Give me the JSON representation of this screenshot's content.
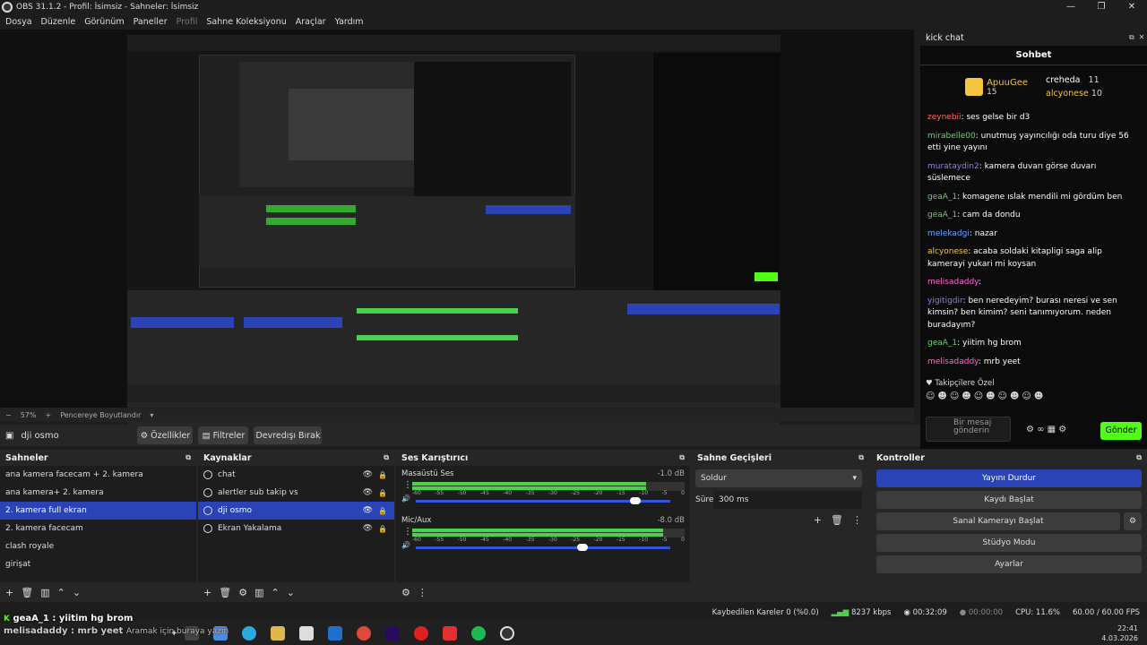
{
  "window": {
    "title": "OBS 31.1.2 - Profil: İsimsiz - Sahneler: İsimsiz",
    "min": "—",
    "max": "❐",
    "close": "✕"
  },
  "menu": [
    "Dosya",
    "Düzenle",
    "Görünüm",
    "Paneller",
    "Profil",
    "Sahne Koleksiyonu",
    "Araçlar",
    "Yardım"
  ],
  "zoom": {
    "level": "57%",
    "fit": "Pencereye Boyutlandır"
  },
  "source_toolbar": {
    "selected": "dji osmo",
    "props": "Özellikler",
    "filters": "Filtreler",
    "deactivate": "Devredışı Bırak"
  },
  "chat": {
    "dock_title": "kick chat",
    "tab": "Sohbet",
    "leaders": [
      {
        "name": "ApuuGee",
        "count": "15",
        "color": "#f5c542"
      },
      {
        "name": "creheda",
        "count": "11",
        "color": "#ffffff"
      },
      {
        "name": "alcyonese",
        "count": "10",
        "color": "#f5c542"
      }
    ],
    "messages": [
      {
        "user": "zeynebii",
        "color": "#ff6b6b",
        "text": ": ses gelse bir d3"
      },
      {
        "user": "mirabelle00",
        "color": "#6bd16b",
        "text": ": unutmuş yayıncılığı oda turu diye 56 etti yine yayını"
      },
      {
        "user": "murataydin2",
        "color": "#8a7fff",
        "text": ": kamera duvarı görse duvarı süslemece"
      },
      {
        "user": "geaA_1",
        "color": "#6bd16b",
        "text": ": komagene ıslak mendili mi gördüm ben"
      },
      {
        "user": "geaA_1",
        "color": "#6bd16b",
        "text": ": cam da dondu"
      },
      {
        "user": "melekadgi",
        "color": "#6ba3ff",
        "text": ": nazar"
      },
      {
        "user": "alcyonese",
        "color": "#f5c542",
        "text": ": acaba soldaki kitapligi saga alip kamerayi yukari mi koysan"
      },
      {
        "user": "melisadaddy",
        "color": "#ff6bd1",
        "text": ": "
      },
      {
        "user": "yigitigdir",
        "color": "#b06bff",
        "text": ": ben neredeyim? burası neresi ve sen kimsin? ben kimim? seni tanımıyorum. neden buradayım?"
      },
      {
        "user": "geaA_1",
        "color": "#6bd16b",
        "text": ": yiitim hg brom"
      },
      {
        "user": "melisadaddy",
        "color": "#ff6bd1",
        "text": ": mrb yeet"
      }
    ],
    "followers_label": "Takipçilere Özel",
    "input_placeholder": "Bir mesaj gönderin",
    "send": "Gönder"
  },
  "scenes": {
    "title": "Sahneler",
    "items": [
      "ana kamera facecam + 2. kamera",
      "ana kamera+ 2. kamera",
      "2. kamera full ekran",
      "2. kamera  facecam",
      "clash royale",
      "girişat"
    ],
    "selected": 2
  },
  "sources": {
    "title": "Kaynaklar",
    "items": [
      "chat",
      "alertler sub takip vs",
      "dji osmo",
      "Ekran Yakalama"
    ],
    "selected": 2
  },
  "mixer": {
    "title": "Ses Karıştırıcı",
    "channels": [
      {
        "name": "Masaüstü Ses",
        "db": "-1.0 dB",
        "level": 0.86,
        "volume": 0.88
      },
      {
        "name": "Mic/Aux",
        "db": "-8.0 dB",
        "level": 0.92,
        "volume": 0.66
      }
    ],
    "ticks": [
      "-60",
      "-55",
      "-50",
      "-45",
      "-40",
      "-35",
      "-30",
      "-25",
      "-20",
      "-15",
      "-10",
      "-5",
      "0"
    ]
  },
  "transitions": {
    "title": "Sahne Geçişleri",
    "type": "Soldur",
    "duration_label": "Süre",
    "duration": "300 ms"
  },
  "controls": {
    "title": "Kontroller",
    "buttons": [
      "Yayını Durdur",
      "Kaydı Başlat",
      "Sanal Kamerayı Başlat",
      "Stüdyo Modu",
      "Ayarlar"
    ]
  },
  "status": {
    "dropped": "Kaybedilen Kareler 0 (%0.0)",
    "bitrate": "8237 kbps",
    "stream_time": "00:32:09",
    "rec_time": "00:00:00",
    "cpu": "CPU: 11.6%",
    "fps": "60.00 / 60.00 FPS"
  },
  "overlay": {
    "line1": "geaA_1 : yiitim hg brom",
    "line2": "melisadaddy : mrb yeet",
    "search": "Aramak için buraya yazın"
  },
  "tray": {
    "time": "22:41",
    "date": "4.03.2026"
  }
}
